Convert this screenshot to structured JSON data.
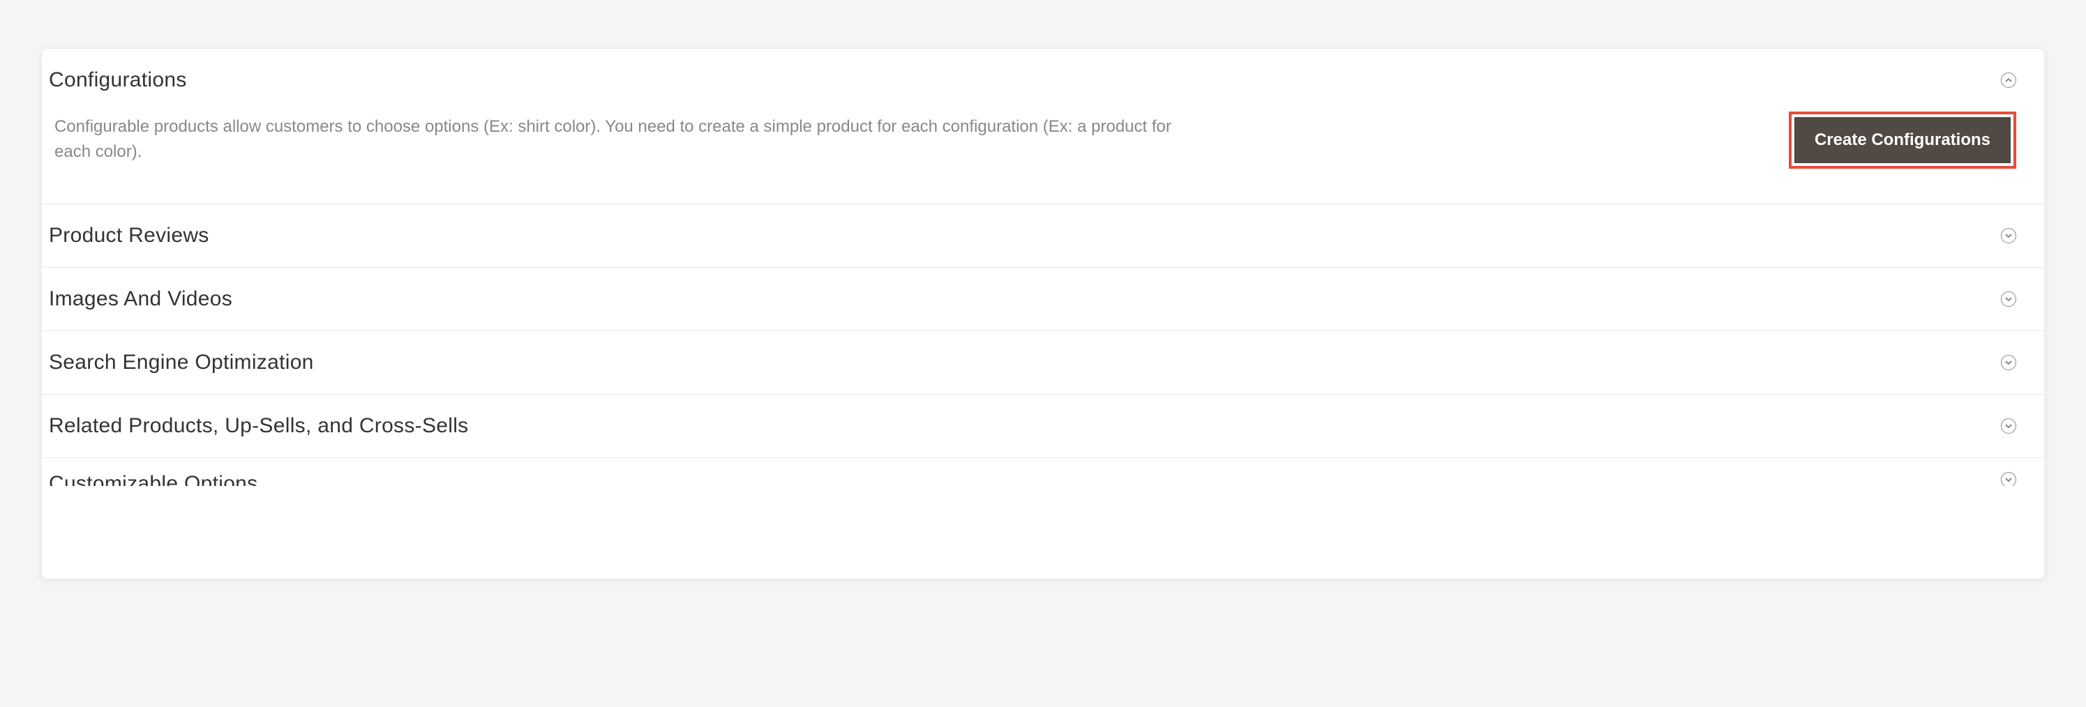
{
  "sections": {
    "configurations": {
      "title": "Configurations",
      "description": "Configurable products allow customers to choose options (Ex: shirt color). You need to create a simple product for each configuration (Ex: a product for each color).",
      "create_button_label": "Create Configurations"
    },
    "product_reviews": {
      "title": "Product Reviews"
    },
    "images_videos": {
      "title": "Images And Videos"
    },
    "seo": {
      "title": "Search Engine Optimization"
    },
    "related_products": {
      "title": "Related Products, Up-Sells, and Cross-Sells"
    },
    "customizable_options": {
      "title": "Customizable Options"
    }
  }
}
